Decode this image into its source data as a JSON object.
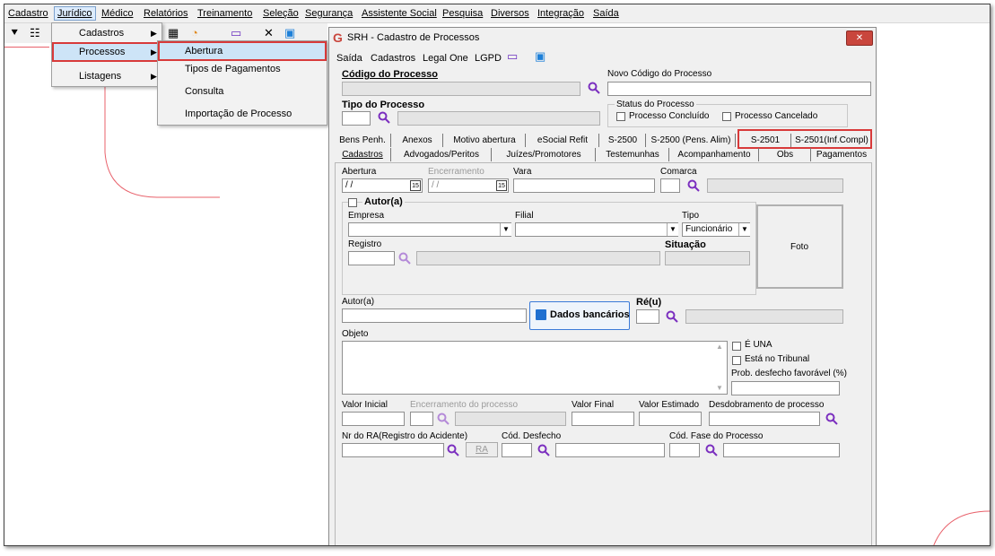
{
  "menubar": {
    "items": [
      "Cadastro",
      "Jurídico",
      "Médico",
      "Relatórios",
      "Treinamento",
      "Seleção",
      "Segurança",
      "Assistente Social",
      "Pesquisa",
      "Diversos",
      "Integração",
      "Saída"
    ]
  },
  "juridico_menu": {
    "items": [
      "Cadastros",
      "Processos",
      "Listagens"
    ]
  },
  "processos_submenu": {
    "items": [
      "Abertura",
      "Tipos de Pagamentos",
      "Consulta",
      "Importação de Processo"
    ]
  },
  "window": {
    "title": "SRH - Cadastro de Processos",
    "menu": [
      "Saída",
      "Cadastros",
      "Legal One",
      "LGPD"
    ]
  },
  "header": {
    "codigo_label": "Código do Processo",
    "novo_codigo_label": "Novo Código do Processo",
    "tipo_label": "Tipo do Processo",
    "status_label": "Status do Processo",
    "concluido_label": "Processo Concluído",
    "cancelado_label": "Processo Cancelado"
  },
  "tabs_row1": [
    "Bens Penh.",
    "Anexos",
    "Motivo abertura",
    "eSocial Refit",
    "S-2500",
    "S-2500 (Pens. Alim)",
    "S-2501",
    "S-2501(Inf.Compl)"
  ],
  "tabs_row2": [
    "Cadastros",
    "Advogados/Peritos",
    "Juízes/Promotores",
    "Testemunhas",
    "Acompanhamento",
    "Obs",
    "Pagamentos"
  ],
  "form": {
    "abertura_label": "Abertura",
    "abertura_value": "/ /",
    "encerramento_label": "Encerramento",
    "encerramento_value": "/ /",
    "vara_label": "Vara",
    "comarca_label": "Comarca",
    "autor_group_label": "Autor(a)",
    "empresa_label": "Empresa",
    "filial_label": "Filial",
    "tipo_label": "Tipo",
    "tipo_value": "Funcionário",
    "registro_label": "Registro",
    "situacao_label": "Situação",
    "foto_label": "Foto",
    "autor_label": "Autor(a)",
    "dados_bancarios_label": "Dados bancários",
    "reu_label": "Ré(u)",
    "objeto_label": "Objeto",
    "e_una_label": "É UNA",
    "esta_tribunal_label": "Está no Tribunal",
    "prob_label": "Prob. desfecho favorável (%)",
    "valor_inicial_label": "Valor Inicial",
    "encerramento_processo_label": "Encerramento do processo",
    "valor_final_label": "Valor Final",
    "valor_estimado_label": "Valor Estimado",
    "desdobramento_label": "Desdobramento de processo",
    "nr_ra_label": "Nr do RA(Registro do Acidente)",
    "ra_button_label": "RA",
    "cod_desfecho_label": "Cód. Desfecho",
    "cod_fase_label": "Cód. Fase do Processo"
  },
  "colors": {
    "highlight": "#d83a3a",
    "selection": "#cde4f7",
    "accent_icon": "#7b2fbf",
    "close_button": "#c9463d"
  }
}
